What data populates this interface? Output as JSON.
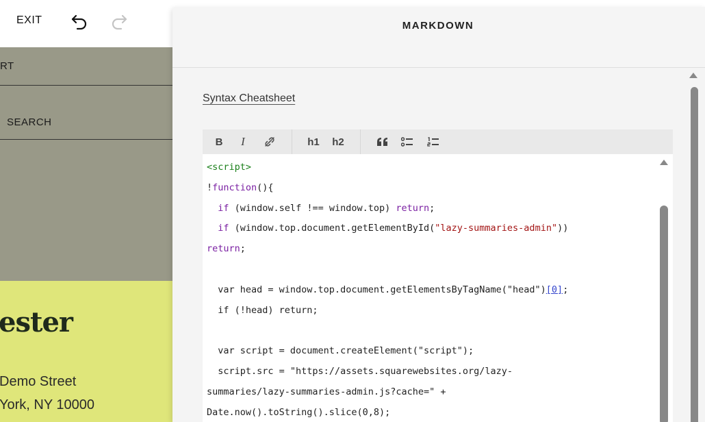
{
  "topbar": {
    "exit_label": "EXIT",
    "undo_icon": "undo-icon",
    "redo_icon": "redo-icon"
  },
  "site": {
    "nav_item_1": "RT",
    "nav_item_2": "SEARCH",
    "hero_title": "ester",
    "address_line_1": "Demo Street",
    "address_line_2": "York, NY 10000",
    "colors": {
      "nav_bg": "#999988",
      "hero_bg": "#dfe67a"
    }
  },
  "panel": {
    "title": "MARKDOWN",
    "cheatsheet_link": "Syntax Cheatsheet",
    "toolbar": {
      "bold": "B",
      "italic": "I",
      "link_icon": "link-icon",
      "h1": "h1",
      "h2": "h2",
      "quote_icon": "quote-icon",
      "bullet_list_icon": "bullet-list-icon",
      "numbered_list_icon": "numbered-list-icon"
    },
    "code": {
      "l1": "<script>",
      "l2a": "!",
      "l2b": "function",
      "l2c": "(){",
      "l3a": "  ",
      "l3b": "if",
      "l3c": " (window.self !== window.top) ",
      "l3d": "return",
      "l3e": ";",
      "l4a": "  ",
      "l4b": "if",
      "l4c": " (window.top.document.getElementById(",
      "l4d": "\"lazy-summaries-admin\"",
      "l4e": "))",
      "l5a": "return",
      "l5b": ";",
      "l7a": "  var head = window.top.document.getElementsByTagName(\"head\")",
      "l7b": "[0]",
      "l7c": ";",
      "l8": "  if (!head) return;",
      "l10": "  var script = document.createElement(\"script\");",
      "l11": "  script.src = \"https://assets.squarewebsites.org/lazy-",
      "l12": "summaries/lazy-summaries-admin.js?cache=\" +",
      "l13": "Date.now().toString().slice(0,8);"
    }
  }
}
